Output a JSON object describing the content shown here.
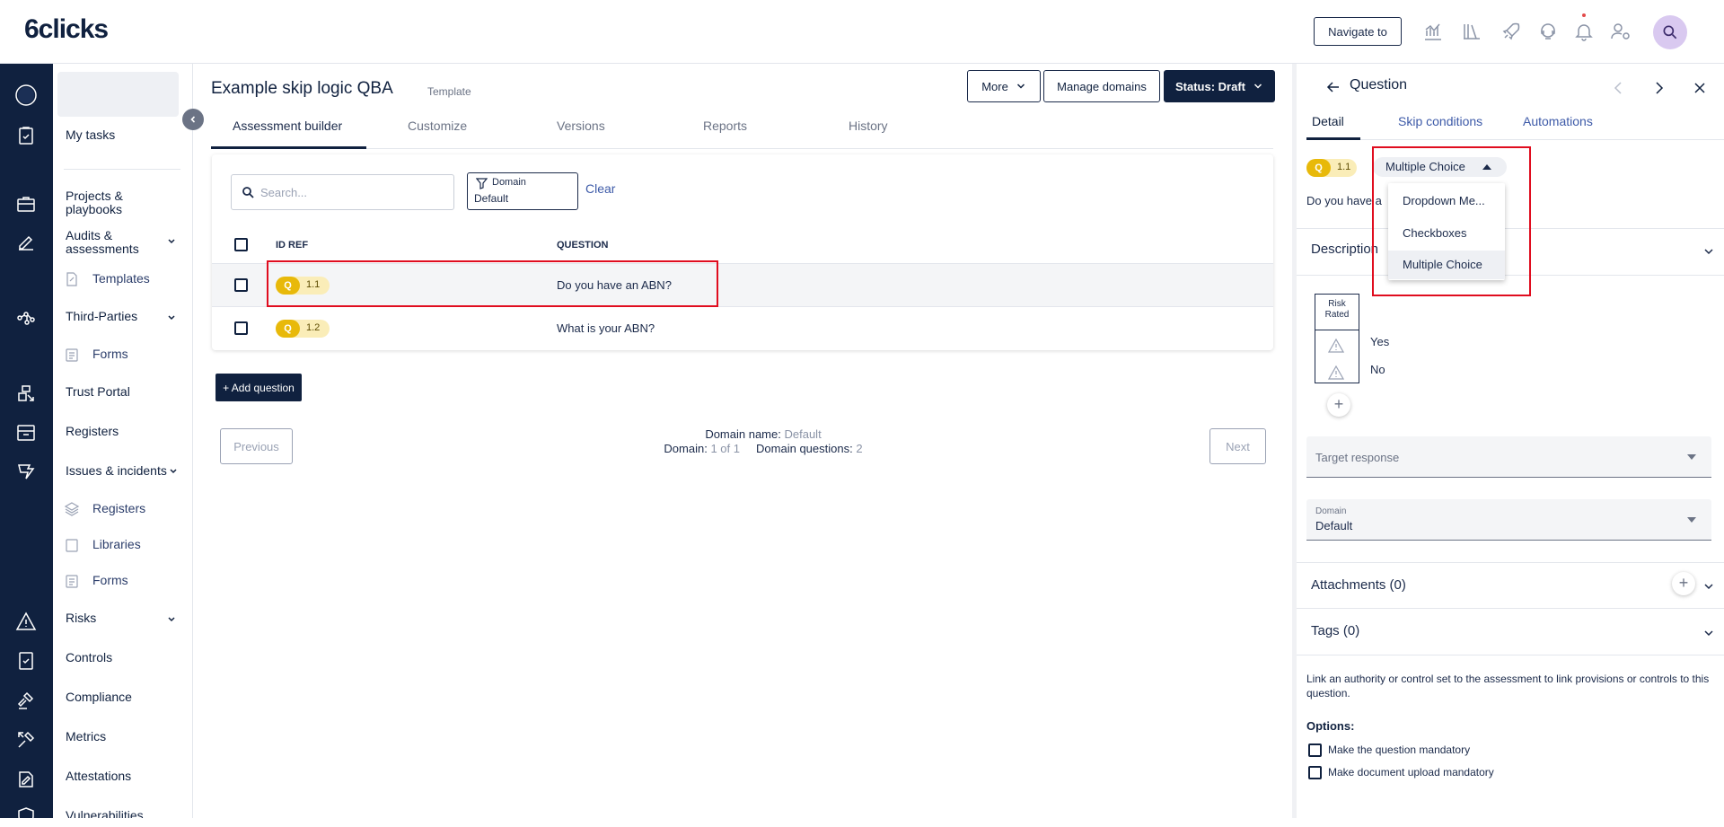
{
  "brand": {
    "logo": "6clicks"
  },
  "header": {
    "navigate_label": "Navigate to"
  },
  "sidebar": {
    "items": {
      "my_tasks": "My tasks",
      "projects": "Projects & playbooks",
      "audits": "Audits & assessments",
      "templates": "Templates",
      "third_parties": "Third-Parties",
      "tp_forms": "Forms",
      "trust_portal": "Trust Portal",
      "registers": "Registers",
      "issues": "Issues & incidents",
      "issues_registers": "Registers",
      "issues_libraries": "Libraries",
      "issues_forms": "Forms",
      "risks": "Risks",
      "controls": "Controls",
      "compliance": "Compliance",
      "metrics": "Metrics",
      "attestations": "Attestations",
      "vulnerabilities": "Vulnerabilities"
    }
  },
  "page": {
    "title": "Example skip logic QBA",
    "tag": "Template",
    "more_label": "More",
    "manage_domains_label": "Manage domains",
    "status_label": "Status: Draft",
    "tabs": [
      "Assessment builder",
      "Customize",
      "Versions",
      "Reports",
      "History"
    ]
  },
  "builder": {
    "search_placeholder": "Search...",
    "domain_filter_label": "Domain",
    "domain_filter_value": "Default",
    "clear_label": "Clear",
    "columns": {
      "id_ref": "ID REF",
      "question": "QUESTION"
    },
    "rows": [
      {
        "badge": "Q",
        "id": "1.1",
        "question": "Do you have an ABN?"
      },
      {
        "badge": "Q",
        "id": "1.2",
        "question": "What is your ABN?"
      }
    ],
    "add_question_label": "+ Add question",
    "previous_label": "Previous",
    "next_label": "Next",
    "domain_name_label": "Domain name:",
    "domain_name_value": "Default",
    "domain_label": "Domain:",
    "domain_value": "1 of 1",
    "domain_questions_label": "Domain questions:",
    "domain_questions_value": "2"
  },
  "panel": {
    "title": "Question",
    "tabs": [
      "Detail",
      "Skip conditions",
      "Automations"
    ],
    "badge": "Q",
    "id": "1.1",
    "type_selected": "Multiple Choice",
    "type_options": [
      "Dropdown Me...",
      "Checkboxes",
      "Multiple Choice"
    ],
    "question_text": "Do you have a",
    "description_label": "Description",
    "risk_rated_label": "Risk Rated",
    "options": [
      "Yes",
      "No"
    ],
    "target_response_placeholder": "Target response",
    "domain_field_label": "Domain",
    "domain_field_value": "Default",
    "attachments_label": "Attachments (0)",
    "tags_label": "Tags (0)",
    "link_note": "Link an authority or control set to the assessment to link provisions or controls to this question.",
    "options_label": "Options:",
    "mandatory_label": "Make the question mandatory",
    "upload_mandatory_label": "Make document upload mandatory"
  },
  "colors": {
    "navy": "#10213f",
    "accent_link": "#3d5aa8",
    "badge_yellow": "#e8b90a",
    "highlight_red": "#e00d1f"
  }
}
